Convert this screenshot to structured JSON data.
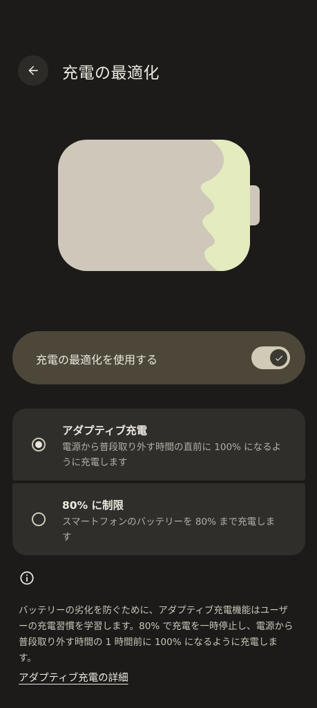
{
  "header": {
    "title": "充電の最適化"
  },
  "toggle": {
    "label": "充電の最適化を使用する",
    "enabled": true
  },
  "options": [
    {
      "title": "アダプティブ充電",
      "description": "電源から普段取り外す時間の直前に 100% になるように充電します",
      "selected": true
    },
    {
      "title": "80% に制限",
      "description": "スマートフォンのバッテリーを 80% まで充電します",
      "selected": false
    }
  ],
  "info": {
    "text": "バッテリーの劣化を防ぐために、アダプティブ充電機能はユーザーの充電習慣を学習します。80% で充電を一時停止し、電源から普段取り外す時間の 1 時間前に 100% になるように充電します。",
    "link": "アダプティブ充電の詳細"
  },
  "colors": {
    "background": "#1c1b19",
    "battery_body": "#cfc7ba",
    "battery_charge": "#e3ebbf",
    "toggle_card": "#4c4738",
    "option_card": "#2f2e2b"
  }
}
